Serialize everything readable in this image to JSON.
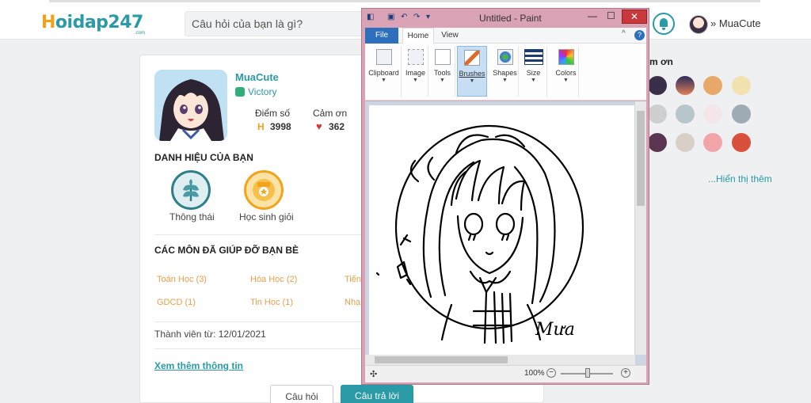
{
  "site": {
    "logo_h": "H",
    "logo_rest": "oidap247",
    "logo_suffix": ".com",
    "search_placeholder": "Câu hỏi của bạn là gì?",
    "username": "MuaCute",
    "user_chevron": "»"
  },
  "profile": {
    "name": "MuaCute",
    "rank": "Victory",
    "score_label": "Điểm số",
    "score_value": "3998",
    "score_icon": "H",
    "thanks_label": "Cảm ơn",
    "thanks_value": "362",
    "thanks_icon": "♥",
    "titles_heading": "DANH HIỆU CỦA BẠN",
    "titles": [
      "Thông thái",
      "Học sinh giỏi"
    ],
    "subjects_heading": "CÁC MÔN ĐÃ GIÚP ĐỠ BẠN BÈ",
    "subjects": [
      "Toán Học (3)",
      "Hóa Học (2)",
      "Tiến",
      "GDCD (1)",
      "Tin Học (1)",
      "Nhạ"
    ],
    "member_since": "Thành viên từ: 12/01/2021",
    "more_info": "Xem thêm thông tin",
    "btn_questions": "Câu hỏi",
    "btn_answers": "Câu trả lời"
  },
  "sidebar": {
    "title": "m ơn",
    "more": "...Hiển thị thêm"
  },
  "paint": {
    "title": "Untitled - Paint",
    "min": "—",
    "max": "☐",
    "close": "✕",
    "tabs": [
      "File",
      "Home",
      "View"
    ],
    "active_tab": "Home",
    "help": "?",
    "collapse": "^",
    "groups": [
      "Clipboard",
      "Image",
      "Tools",
      "Brushes",
      "Shapes",
      "Size",
      "Colors"
    ],
    "highlighted_group": "Brushes",
    "signature": "Mưa",
    "zoom": "100%",
    "zoom_minus": "−",
    "zoom_plus": "+",
    "move_icon": "✣"
  },
  "colors": {
    "accent": "#2a9aa7",
    "logo_orange": "#f0a21a",
    "subject_orange": "#e8a04a",
    "paint_frame": "#d9a3b5",
    "close_red": "#c9393b"
  }
}
